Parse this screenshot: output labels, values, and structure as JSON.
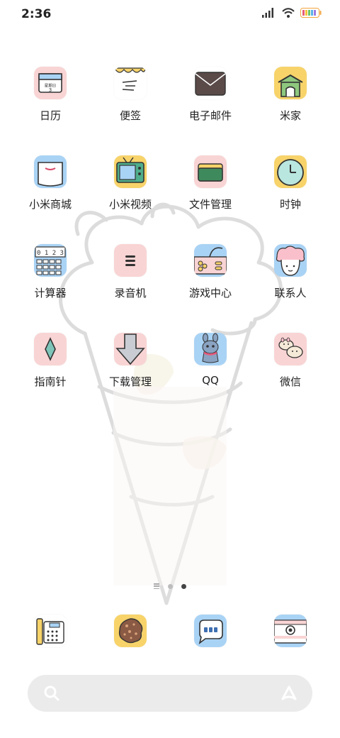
{
  "status_bar": {
    "time": "2:36",
    "icons": [
      "signal-icon",
      "wifi-icon",
      "battery-icon"
    ]
  },
  "apps": [
    {
      "label": "日历",
      "icon": "calendar-icon",
      "badge_text": [
        "星期日",
        "3"
      ],
      "bg": "#f9d4d4"
    },
    {
      "label": "便签",
      "icon": "notes-icon",
      "bg": "#ffffff"
    },
    {
      "label": "电子邮件",
      "icon": "mail-icon",
      "bg": "#ffffff"
    },
    {
      "label": "米家",
      "icon": "home-icon",
      "bg": "#f7d36a"
    },
    {
      "label": "小米商城",
      "icon": "store-icon",
      "bg": "#a9d3f5"
    },
    {
      "label": "小米视频",
      "icon": "tv-icon",
      "bg": "#f7d36a"
    },
    {
      "label": "文件管理",
      "icon": "folder-icon",
      "bg": "#f9d4d4"
    },
    {
      "label": "时钟",
      "icon": "clock-icon",
      "bg": "#f7d36a"
    },
    {
      "label": "计算器",
      "icon": "calculator-icon",
      "bg": "#a9d3f5",
      "keypad_text": "0 1 2 3"
    },
    {
      "label": "录音机",
      "icon": "recorder-icon",
      "bg": "#f9d4d4"
    },
    {
      "label": "游戏中心",
      "icon": "game-icon",
      "bg": "#a9d3f5"
    },
    {
      "label": "联系人",
      "icon": "contacts-icon",
      "bg": "#a9d3f5"
    },
    {
      "label": "指南针",
      "icon": "compass-icon",
      "bg": "#f9d4d4"
    },
    {
      "label": "下载管理",
      "icon": "download-icon",
      "bg": "#f9d4d4"
    },
    {
      "label": "QQ",
      "icon": "qq-icon",
      "bg": "#a9d3f5"
    },
    {
      "label": "微信",
      "icon": "wechat-icon",
      "bg": "#f9d4d4"
    }
  ],
  "pager": {
    "pages": 2,
    "active_page": 2
  },
  "dock": [
    {
      "icon": "phone-icon",
      "bg": "#ffffff"
    },
    {
      "icon": "cookie-icon",
      "bg": "#f7d36a"
    },
    {
      "icon": "messages-icon",
      "bg": "#a9d3f5"
    },
    {
      "icon": "camera-icon",
      "bg": "#a9d3f5"
    }
  ],
  "search": {
    "icon": "search-icon",
    "assistant_icon": "assistant-icon"
  },
  "colors": {
    "pink": "#f9d4d4",
    "yellow": "#f7d36a",
    "blue": "#a9d3f5",
    "searchbar": "#ebebeb"
  }
}
